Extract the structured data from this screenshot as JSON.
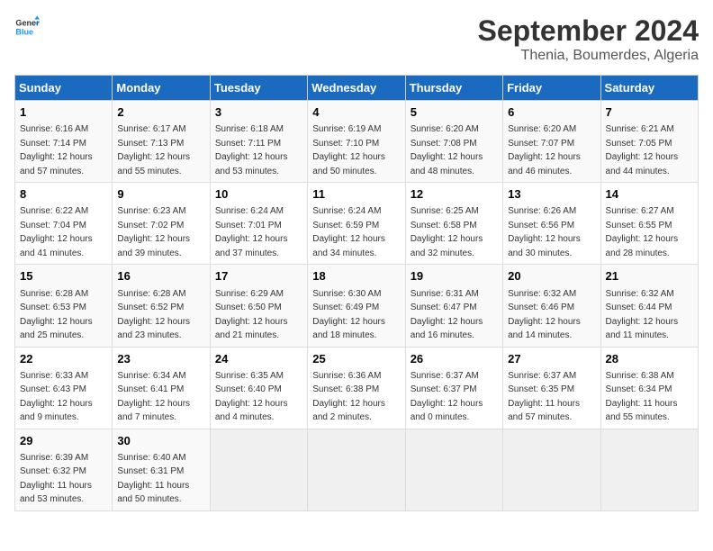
{
  "header": {
    "logo_line1": "General",
    "logo_line2": "Blue",
    "month": "September 2024",
    "location": "Thenia, Boumerdes, Algeria"
  },
  "weekdays": [
    "Sunday",
    "Monday",
    "Tuesday",
    "Wednesday",
    "Thursday",
    "Friday",
    "Saturday"
  ],
  "weeks": [
    [
      {
        "day": "1",
        "sunrise": "6:16 AM",
        "sunset": "7:14 PM",
        "daylight": "12 hours and 57 minutes."
      },
      {
        "day": "2",
        "sunrise": "6:17 AM",
        "sunset": "7:13 PM",
        "daylight": "12 hours and 55 minutes."
      },
      {
        "day": "3",
        "sunrise": "6:18 AM",
        "sunset": "7:11 PM",
        "daylight": "12 hours and 53 minutes."
      },
      {
        "day": "4",
        "sunrise": "6:19 AM",
        "sunset": "7:10 PM",
        "daylight": "12 hours and 50 minutes."
      },
      {
        "day": "5",
        "sunrise": "6:20 AM",
        "sunset": "7:08 PM",
        "daylight": "12 hours and 48 minutes."
      },
      {
        "day": "6",
        "sunrise": "6:20 AM",
        "sunset": "7:07 PM",
        "daylight": "12 hours and 46 minutes."
      },
      {
        "day": "7",
        "sunrise": "6:21 AM",
        "sunset": "7:05 PM",
        "daylight": "12 hours and 44 minutes."
      }
    ],
    [
      {
        "day": "8",
        "sunrise": "6:22 AM",
        "sunset": "7:04 PM",
        "daylight": "12 hours and 41 minutes."
      },
      {
        "day": "9",
        "sunrise": "6:23 AM",
        "sunset": "7:02 PM",
        "daylight": "12 hours and 39 minutes."
      },
      {
        "day": "10",
        "sunrise": "6:24 AM",
        "sunset": "7:01 PM",
        "daylight": "12 hours and 37 minutes."
      },
      {
        "day": "11",
        "sunrise": "6:24 AM",
        "sunset": "6:59 PM",
        "daylight": "12 hours and 34 minutes."
      },
      {
        "day": "12",
        "sunrise": "6:25 AM",
        "sunset": "6:58 PM",
        "daylight": "12 hours and 32 minutes."
      },
      {
        "day": "13",
        "sunrise": "6:26 AM",
        "sunset": "6:56 PM",
        "daylight": "12 hours and 30 minutes."
      },
      {
        "day": "14",
        "sunrise": "6:27 AM",
        "sunset": "6:55 PM",
        "daylight": "12 hours and 28 minutes."
      }
    ],
    [
      {
        "day": "15",
        "sunrise": "6:28 AM",
        "sunset": "6:53 PM",
        "daylight": "12 hours and 25 minutes."
      },
      {
        "day": "16",
        "sunrise": "6:28 AM",
        "sunset": "6:52 PM",
        "daylight": "12 hours and 23 minutes."
      },
      {
        "day": "17",
        "sunrise": "6:29 AM",
        "sunset": "6:50 PM",
        "daylight": "12 hours and 21 minutes."
      },
      {
        "day": "18",
        "sunrise": "6:30 AM",
        "sunset": "6:49 PM",
        "daylight": "12 hours and 18 minutes."
      },
      {
        "day": "19",
        "sunrise": "6:31 AM",
        "sunset": "6:47 PM",
        "daylight": "12 hours and 16 minutes."
      },
      {
        "day": "20",
        "sunrise": "6:32 AM",
        "sunset": "6:46 PM",
        "daylight": "12 hours and 14 minutes."
      },
      {
        "day": "21",
        "sunrise": "6:32 AM",
        "sunset": "6:44 PM",
        "daylight": "12 hours and 11 minutes."
      }
    ],
    [
      {
        "day": "22",
        "sunrise": "6:33 AM",
        "sunset": "6:43 PM",
        "daylight": "12 hours and 9 minutes."
      },
      {
        "day": "23",
        "sunrise": "6:34 AM",
        "sunset": "6:41 PM",
        "daylight": "12 hours and 7 minutes."
      },
      {
        "day": "24",
        "sunrise": "6:35 AM",
        "sunset": "6:40 PM",
        "daylight": "12 hours and 4 minutes."
      },
      {
        "day": "25",
        "sunrise": "6:36 AM",
        "sunset": "6:38 PM",
        "daylight": "12 hours and 2 minutes."
      },
      {
        "day": "26",
        "sunrise": "6:37 AM",
        "sunset": "6:37 PM",
        "daylight": "12 hours and 0 minutes."
      },
      {
        "day": "27",
        "sunrise": "6:37 AM",
        "sunset": "6:35 PM",
        "daylight": "11 hours and 57 minutes."
      },
      {
        "day": "28",
        "sunrise": "6:38 AM",
        "sunset": "6:34 PM",
        "daylight": "11 hours and 55 minutes."
      }
    ],
    [
      {
        "day": "29",
        "sunrise": "6:39 AM",
        "sunset": "6:32 PM",
        "daylight": "11 hours and 53 minutes."
      },
      {
        "day": "30",
        "sunrise": "6:40 AM",
        "sunset": "6:31 PM",
        "daylight": "11 hours and 50 minutes."
      },
      null,
      null,
      null,
      null,
      null
    ]
  ]
}
